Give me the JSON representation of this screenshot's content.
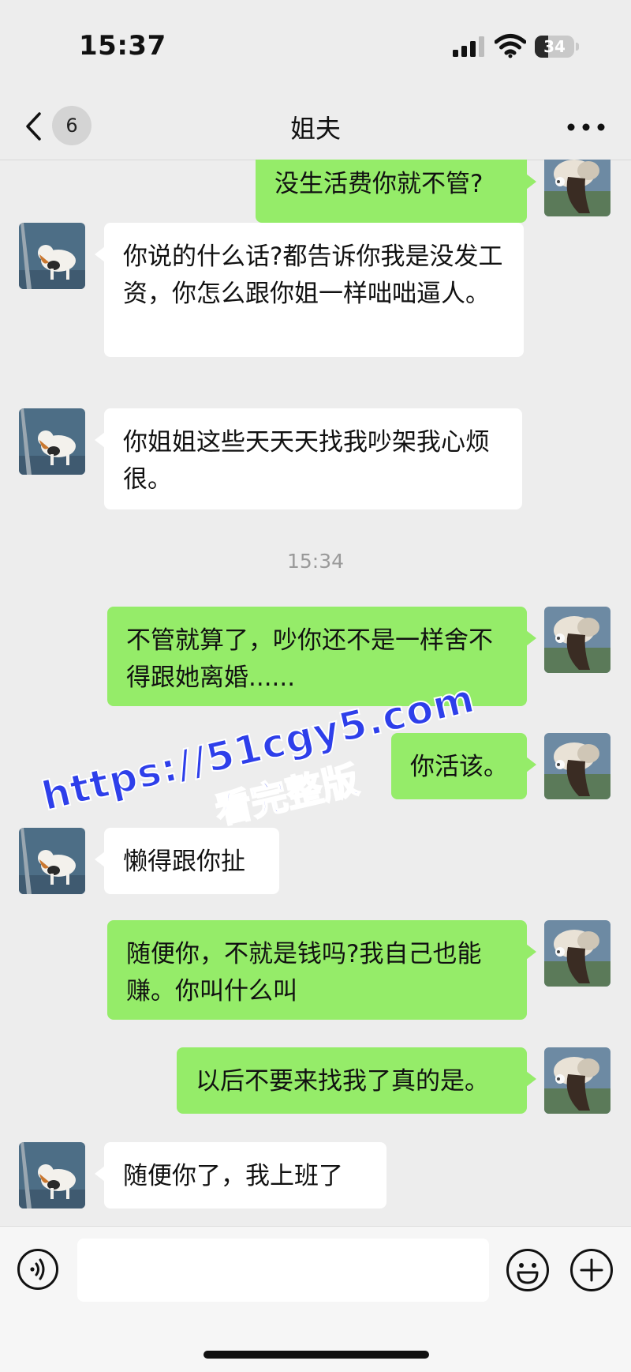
{
  "status_bar": {
    "time": "15:37",
    "battery_percent": "34",
    "battery_level": 0.34
  },
  "header": {
    "back_badge": "6",
    "title": "姐夫"
  },
  "messages": [
    {
      "side": "out",
      "text": "没生活费你就不管?"
    },
    {
      "side": "in",
      "text": "你说的什么话?都告诉你我是没发工资，你怎么跟你姐一样咄咄逼人。"
    },
    {
      "side": "in",
      "text": "你姐姐这些天天天找我吵架我心烦很。"
    },
    {
      "side": "time",
      "text": "15:34"
    },
    {
      "side": "out",
      "text": "不管就算了，吵你还不是一样舍不得跟她离婚......"
    },
    {
      "side": "out",
      "text": "你活该。"
    },
    {
      "side": "in",
      "text": "懒得跟你扯"
    },
    {
      "side": "out",
      "text": "随便你，不就是钱吗?我自己也能赚。你叫什么叫"
    },
    {
      "side": "out",
      "text": "以后不要来找我了真的是。"
    },
    {
      "side": "in",
      "text": "随便你了，我上班了"
    }
  ],
  "watermark": {
    "line1": "https://51cgy5.com",
    "line2": "看完整版"
  },
  "input_bar": {
    "placeholder": ""
  },
  "colors": {
    "background": "#ededed",
    "outgoing_bubble": "#95ec69",
    "incoming_bubble": "#ffffff",
    "watermark": "#2e3fea"
  }
}
